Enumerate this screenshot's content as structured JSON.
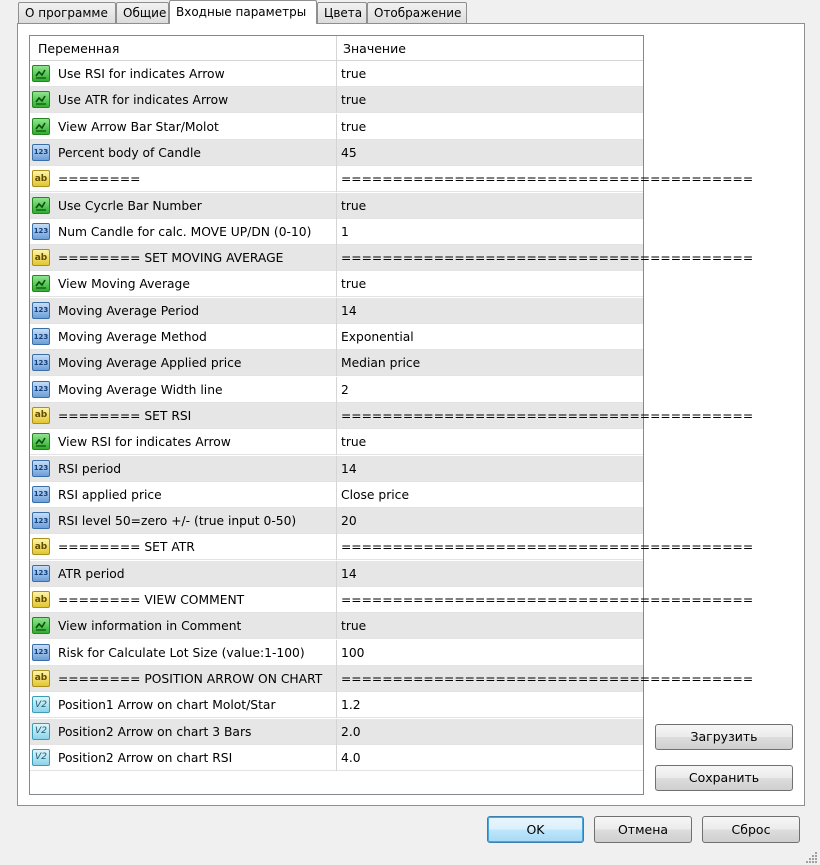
{
  "tabs": [
    {
      "label": "О программе",
      "active": false
    },
    {
      "label": "Общие",
      "active": false
    },
    {
      "label": "Входные параметры",
      "active": true
    },
    {
      "label": "Цвета",
      "active": false
    },
    {
      "label": "Отображение",
      "active": false
    }
  ],
  "grid": {
    "col_variable": "Переменная",
    "col_value": "Значение",
    "rows": [
      {
        "type": "bool",
        "name": "Use RSI for indicates Arrow",
        "value": "true"
      },
      {
        "type": "bool",
        "name": "Use ATR for indicates Arrow",
        "value": "true"
      },
      {
        "type": "bool",
        "name": "View Arrow Bar Star/Molot",
        "value": "true"
      },
      {
        "type": "int",
        "name": "Percent body of Candle",
        "value": "45"
      },
      {
        "type": "str",
        "name": "========",
        "value": "========================================"
      },
      {
        "type": "bool",
        "name": "Use Cycrle Bar Number",
        "value": "true"
      },
      {
        "type": "int",
        "name": "Num Candle for calc. MOVE UP/DN (0-10)",
        "value": "1"
      },
      {
        "type": "str",
        "name": "======== SET MOVING AVERAGE",
        "value": "========================================"
      },
      {
        "type": "bool",
        "name": "View Moving Average",
        "value": "true"
      },
      {
        "type": "int",
        "name": "Moving Average Period",
        "value": "14"
      },
      {
        "type": "int",
        "name": "Moving Average Method",
        "value": "Exponential"
      },
      {
        "type": "int",
        "name": "Moving Average Applied price",
        "value": "Median price"
      },
      {
        "type": "int",
        "name": "Moving Average Width line",
        "value": "2"
      },
      {
        "type": "str",
        "name": "======== SET RSI",
        "value": "========================================"
      },
      {
        "type": "bool",
        "name": "View RSI for indicates Arrow",
        "value": "true"
      },
      {
        "type": "int",
        "name": "RSI period",
        "value": "14"
      },
      {
        "type": "int",
        "name": "RSI applied price",
        "value": "Close price"
      },
      {
        "type": "int",
        "name": "RSI level 50=zero +/- (true input 0-50)",
        "value": "20"
      },
      {
        "type": "str",
        "name": "======== SET ATR",
        "value": "========================================"
      },
      {
        "type": "int",
        "name": "ATR period",
        "value": "14"
      },
      {
        "type": "str",
        "name": "======== VIEW COMMENT",
        "value": "========================================"
      },
      {
        "type": "bool",
        "name": "View information in Comment",
        "value": "true"
      },
      {
        "type": "int",
        "name": "Risk for Calculate Lot Size (value:1-100)",
        "value": "100"
      },
      {
        "type": "str",
        "name": "======== POSITION ARROW ON CHART",
        "value": "========================================"
      },
      {
        "type": "dbl",
        "name": "Position1 Arrow on chart Molot/Star",
        "value": "1.2"
      },
      {
        "type": "dbl",
        "name": "Position2 Arrow on chart 3 Bars",
        "value": "2.0"
      },
      {
        "type": "dbl",
        "name": "Position2 Arrow on chart RSI",
        "value": "4.0"
      }
    ]
  },
  "icons": {
    "int": "123",
    "str": "ab",
    "dbl": "V2",
    "bool": "bool-arrow-icon"
  },
  "buttons": {
    "load": "Загрузить",
    "save": "Сохранить",
    "ok": "OK",
    "cancel": "Отмена",
    "reset": "Сброс"
  }
}
